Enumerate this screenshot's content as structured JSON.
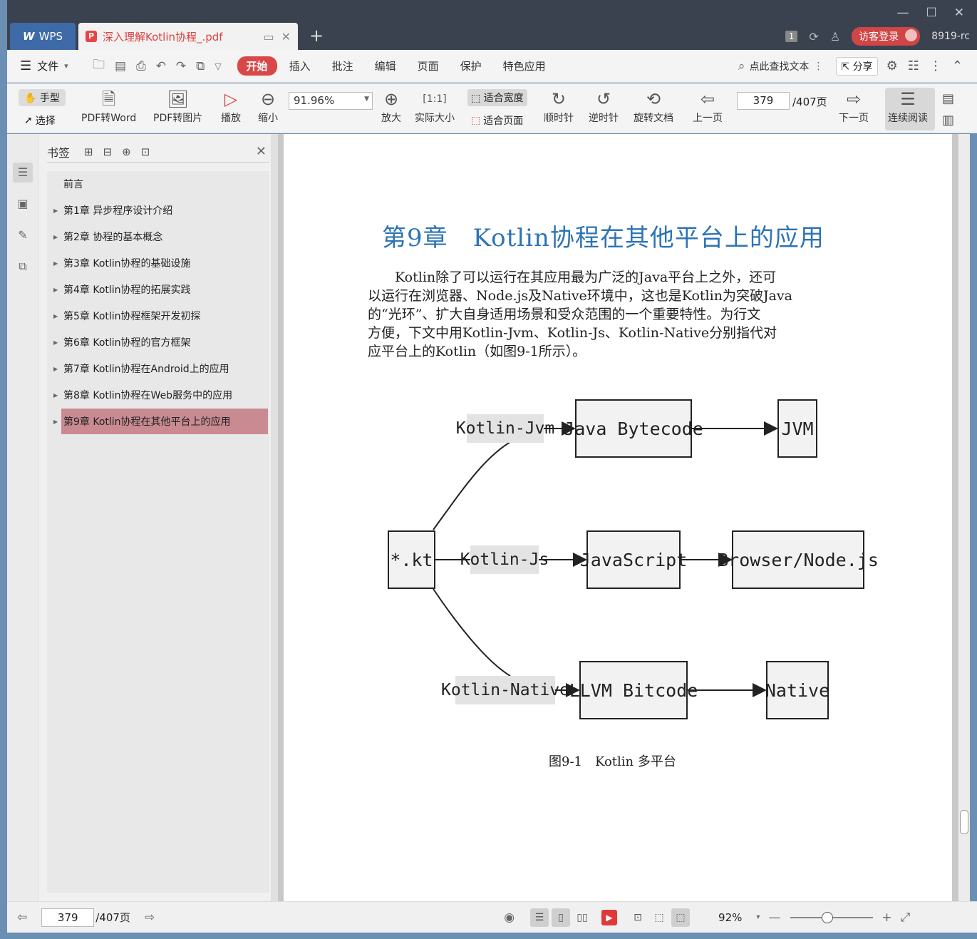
{
  "titlebar": {
    "app_tab": "WPS",
    "doc_tab": "深入理解Kotlin协程_.pdf",
    "page_count_badge": "1",
    "login_label": "访客登录",
    "user_id": "8919-rc"
  },
  "menu": {
    "file": "文件",
    "tabs": [
      "开始",
      "插入",
      "批注",
      "编辑",
      "页面",
      "保护",
      "特色应用"
    ],
    "search_placeholder": "点此查找文本",
    "share": "分享"
  },
  "toolbar": {
    "hand": "手型",
    "select": "选择",
    "pdf_to_word": "PDF转Word",
    "pdf_to_image": "PDF转图片",
    "play": "播放",
    "zoom_out": "缩小",
    "zoom_value": "91.96%",
    "zoom_in": "放大",
    "actual_size": "实际大小",
    "fit_width": "适合宽度",
    "fit_page": "适合页面",
    "clockwise": "顺时针",
    "counter_clockwise": "逆时针",
    "rotate_doc": "旋转文档",
    "prev_page": "上一页",
    "current_page": "379",
    "total_pages": "/407页",
    "next_page": "下一页",
    "continuous": "连续阅读"
  },
  "bookmarks": {
    "title": "书签",
    "items": [
      "前言",
      "第1章 异步程序设计介绍",
      "第2章 协程的基本概念",
      "第3章 Kotlin协程的基础设施",
      "第4章 Kotlin协程的拓展实践",
      "第5章 Kotlin协程框架开发初探",
      "第6章 Kotlin协程的官方框架",
      "第7章 Kotlin协程在Android上的应用",
      "第8章 Kotlin协程在Web服务中的应用",
      "第9章 Kotlin协程在其他平台上的应用"
    ],
    "selected_index": 9
  },
  "document": {
    "chapter_title": "第9章　Kotlin协程在其他平台上的应用",
    "paragraph_lines": [
      "　　Kotlin除了可以运行在其应用最为广泛的Java平台上之外，还可",
      "以运行在浏览器、Node.js及Native环境中，这也是Kotlin为突破Java",
      "的“光环”、扩大自身适用场景和受众范围的一个重要特性。为行文",
      "方便，下文中用Kotlin-Jvm、Kotlin-Js、Kotlin-Native分别指代对",
      "应平台上的Kotlin（如图9-1所示）。"
    ],
    "figure": {
      "source": "*.kt",
      "rows": [
        {
          "edge": "Kotlin-Jvm",
          "mid": "Java Bytecode",
          "end": "JVM"
        },
        {
          "edge": "Kotlin-Js",
          "mid": "JavaScript",
          "end": "Browser/Node.js"
        },
        {
          "edge": "Kotlin-Native",
          "mid": "LLVM Bitcode",
          "end": "Native"
        }
      ]
    },
    "caption": "图9-1　Kotlin 多平台"
  },
  "statusbar": {
    "current_page": "379",
    "total_pages": "/407页",
    "zoom": "92%"
  },
  "colors": {
    "accent_red": "#d94848",
    "title_blue": "#2e74b5",
    "selected_bookmark": "#c98a92"
  }
}
